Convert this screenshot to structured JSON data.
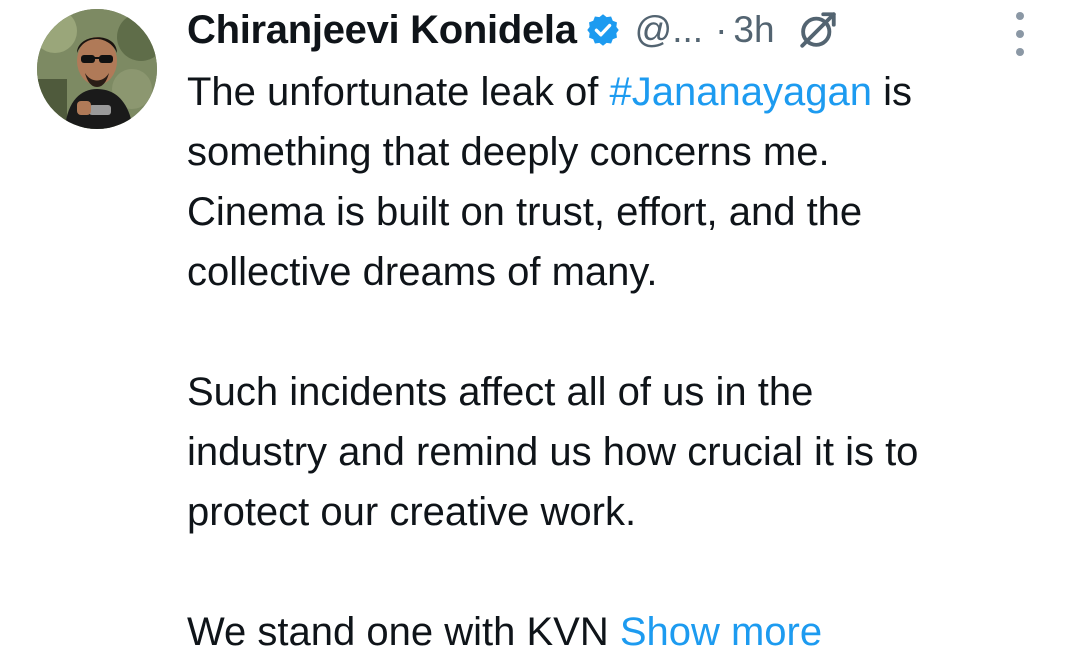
{
  "tweet": {
    "display_name": "Chiranjeevi Konidela",
    "handle": "@...",
    "separator": "·",
    "timestamp": "3h",
    "colors": {
      "link": "#1d9bf0",
      "verified": "#1d9bf0",
      "secondary_text": "#536471",
      "primary_text": "#0f1419"
    },
    "icons": {
      "verified": "verified-badge-icon",
      "grok": "grok-icon",
      "more": "more-options-icon"
    },
    "text": {
      "p1_l1_a": "The unfortunate leak of ",
      "p1_l1_hashtag": "#Jananayagan",
      "p1_l1_b": " is",
      "p1_l2": "something that deeply concerns me.",
      "p1_l3": "Cinema is built on trust, effort, and the",
      "p1_l4": "collective dreams of many.",
      "p2_l1": "Such incidents affect all of us in the",
      "p2_l2": "industry and remind us how crucial it is to",
      "p2_l3": "protect our creative work.",
      "p3_l1": "We stand one with KVN ",
      "show_more": "Show more"
    }
  }
}
